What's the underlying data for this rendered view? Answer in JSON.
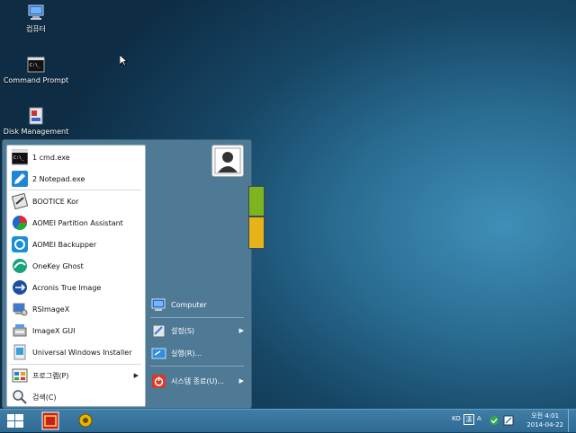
{
  "desktop": {
    "icons": [
      {
        "label": "컴퓨터"
      },
      {
        "label": "Command Prompt"
      },
      {
        "label": "Disk Management"
      }
    ]
  },
  "start_menu": {
    "recent": [
      {
        "label": "1 cmd.exe"
      },
      {
        "label": "2 Notepad.exe"
      }
    ],
    "programs": [
      {
        "label": "BOOTICE Kor"
      },
      {
        "label": "AOMEI Partition Assistant"
      },
      {
        "label": "AOMEI Backupper"
      },
      {
        "label": "OneKey Ghost"
      },
      {
        "label": "Acronis True Image"
      },
      {
        "label": "RSImageX"
      },
      {
        "label": "ImageX GUI"
      },
      {
        "label": "Universal Windows Installer"
      }
    ],
    "programs_label": "프로그램(P)",
    "search_label": "검색(C)",
    "right": {
      "computer": "Computer",
      "settings": "설정(S)",
      "run": "실행(R)...",
      "shutdown": "시스템 종료(U)..."
    }
  },
  "taskbar": {
    "tray_ime": "KO",
    "tray_a": "A",
    "clock_time": "오전 4:01",
    "clock_date": "2014-04-22"
  },
  "colors": {
    "tile_green": "#7cb51f",
    "tile_yellow": "#e6b417",
    "shutdown_red": "#d63b2b"
  }
}
